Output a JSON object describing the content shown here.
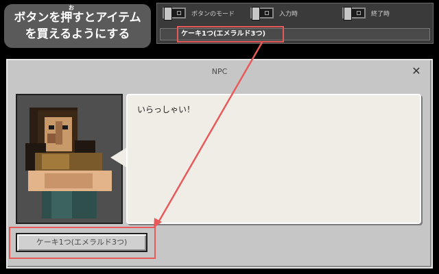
{
  "caption": {
    "furigana": "お",
    "line1": "ボタンを押すとアイテム",
    "line2": "を買えるようにする"
  },
  "editor": {
    "toggles": [
      {
        "label": "ボタンのモード",
        "state": "left"
      },
      {
        "label": "入力時",
        "state": "left"
      },
      {
        "label": "終了時",
        "state": "left"
      }
    ],
    "command_value": "ケーキ1つ(エメラルド3つ)"
  },
  "dialog": {
    "title": "NPC",
    "close_icon": "close-icon",
    "speech_text": "いらっしゃい！",
    "action_button_label": "ケーキ1つ(エメラルド3つ)"
  },
  "colors": {
    "highlight": "#e85a5a",
    "dialog_bg": "#c6c6c6",
    "speech_bg": "#f0ece6"
  }
}
